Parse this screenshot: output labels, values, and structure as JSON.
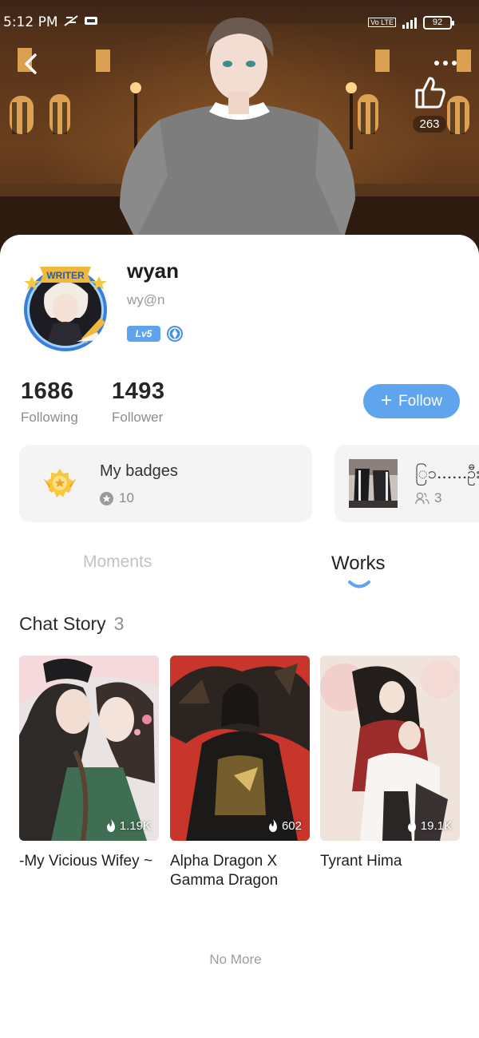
{
  "status_bar": {
    "time": "5:12 PM",
    "network_tag": "Vo LTE",
    "battery": "92"
  },
  "header": {
    "likes": "263"
  },
  "profile": {
    "username": "wyan",
    "handle": "wy@n",
    "level": "Lv5",
    "avatar_label": "WRITER"
  },
  "stats": {
    "following_count": "1686",
    "following_label": "Following",
    "follower_count": "1493",
    "follower_label": "Follower"
  },
  "follow_button": {
    "label": "Follow"
  },
  "badges": {
    "title": "My badges",
    "count": "10"
  },
  "group": {
    "name": "ြ၁......ဦး",
    "members": "3"
  },
  "tabs": [
    {
      "label": "Moments",
      "active": false
    },
    {
      "label": "Works",
      "active": true
    }
  ],
  "section": {
    "title": "Chat Story",
    "count": "3"
  },
  "stories": [
    {
      "title": "-My Vicious Wifey ~",
      "heat": "1.19K"
    },
    {
      "title": "Alpha Dragon X Gamma Dragon",
      "heat": "602"
    },
    {
      "title": "Tyrant Hima",
      "heat": "19.1K"
    }
  ],
  "footer": {
    "no_more": "No More"
  },
  "colors": {
    "accent": "#5fa4ef",
    "text_primary": "#222222",
    "text_muted": "#8c8c8c",
    "card_bg": "#f4f4f5"
  }
}
